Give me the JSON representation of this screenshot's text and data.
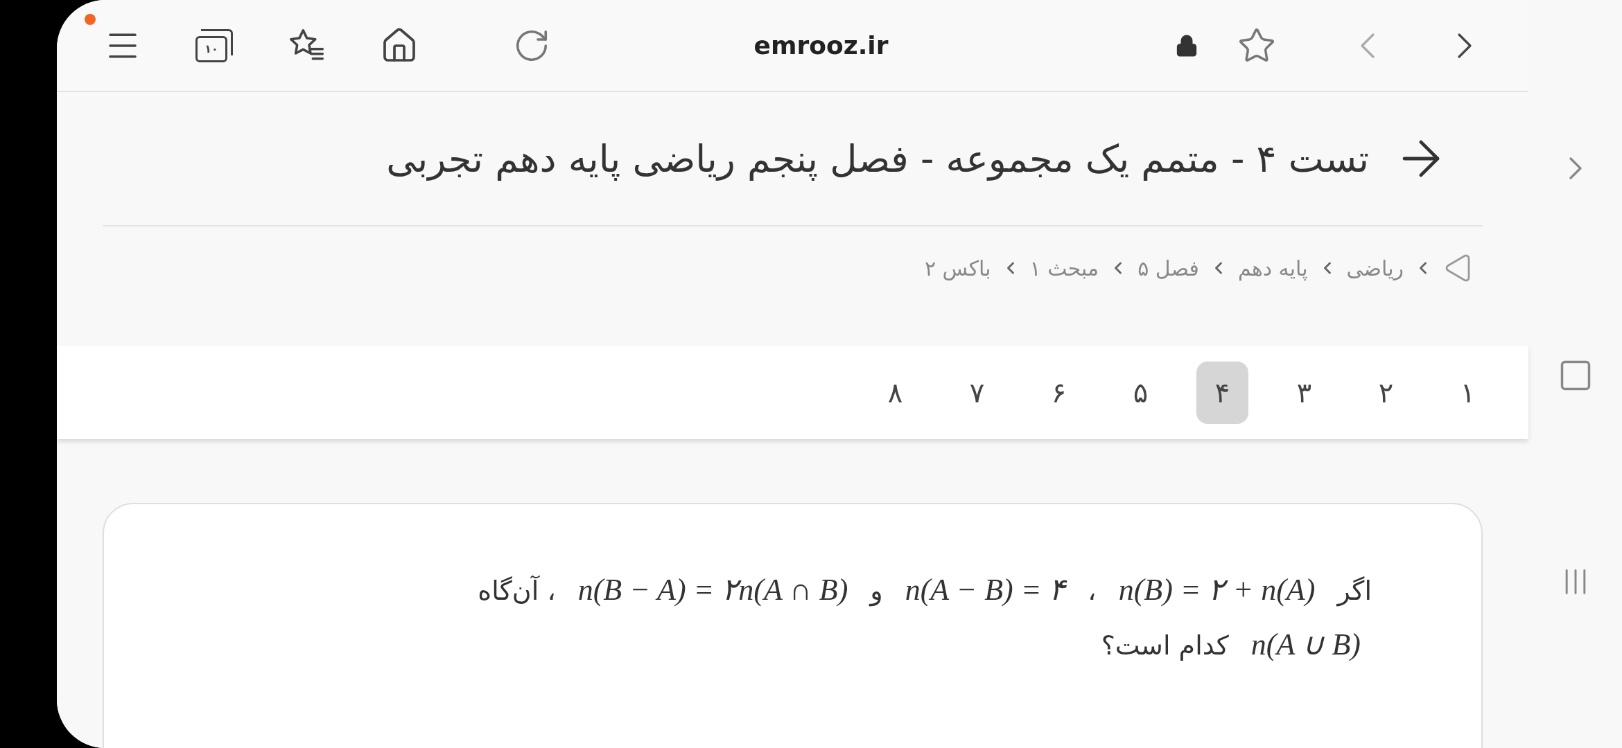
{
  "browser": {
    "url": "emrooz.ir",
    "tab_count": "۱۰",
    "notification": true,
    "back_enabled": false,
    "forward_enabled": true
  },
  "page": {
    "title": "تست ۴ - متمم یک مجموعه - فصل پنجم ریاضی پایه دهم تجربی",
    "breadcrumb": [
      "ریاضی",
      "پایه دهم",
      "فصل ۵",
      "مبحث ۱",
      "باکس ۲"
    ],
    "pagination": [
      {
        "label": "۱",
        "selected": false
      },
      {
        "label": "۲",
        "selected": false
      },
      {
        "label": "۳",
        "selected": false
      },
      {
        "label": "۴",
        "selected": true
      },
      {
        "label": "۵",
        "selected": false
      },
      {
        "label": "۶",
        "selected": false
      },
      {
        "label": "۷",
        "selected": false
      },
      {
        "label": "۸",
        "selected": false
      }
    ],
    "question": {
      "lines": [
        [
          {
            "kind": "text",
            "text": "اگر"
          },
          {
            "kind": "math",
            "text": "n(B) = ۲ + n(A)"
          },
          {
            "kind": "text",
            "text": "،"
          },
          {
            "kind": "math",
            "text": "n(A − B) = ۴"
          },
          {
            "kind": "text",
            "text": "و"
          },
          {
            "kind": "math",
            "text": "n(B − A) = ۲n(A ∩ B)"
          },
          {
            "kind": "text",
            "text": "، آن‌گاه"
          }
        ],
        [
          {
            "kind": "math",
            "text": "n(A ∪ B)"
          },
          {
            "kind": "text",
            "text": "کدام است؟"
          }
        ]
      ]
    }
  }
}
